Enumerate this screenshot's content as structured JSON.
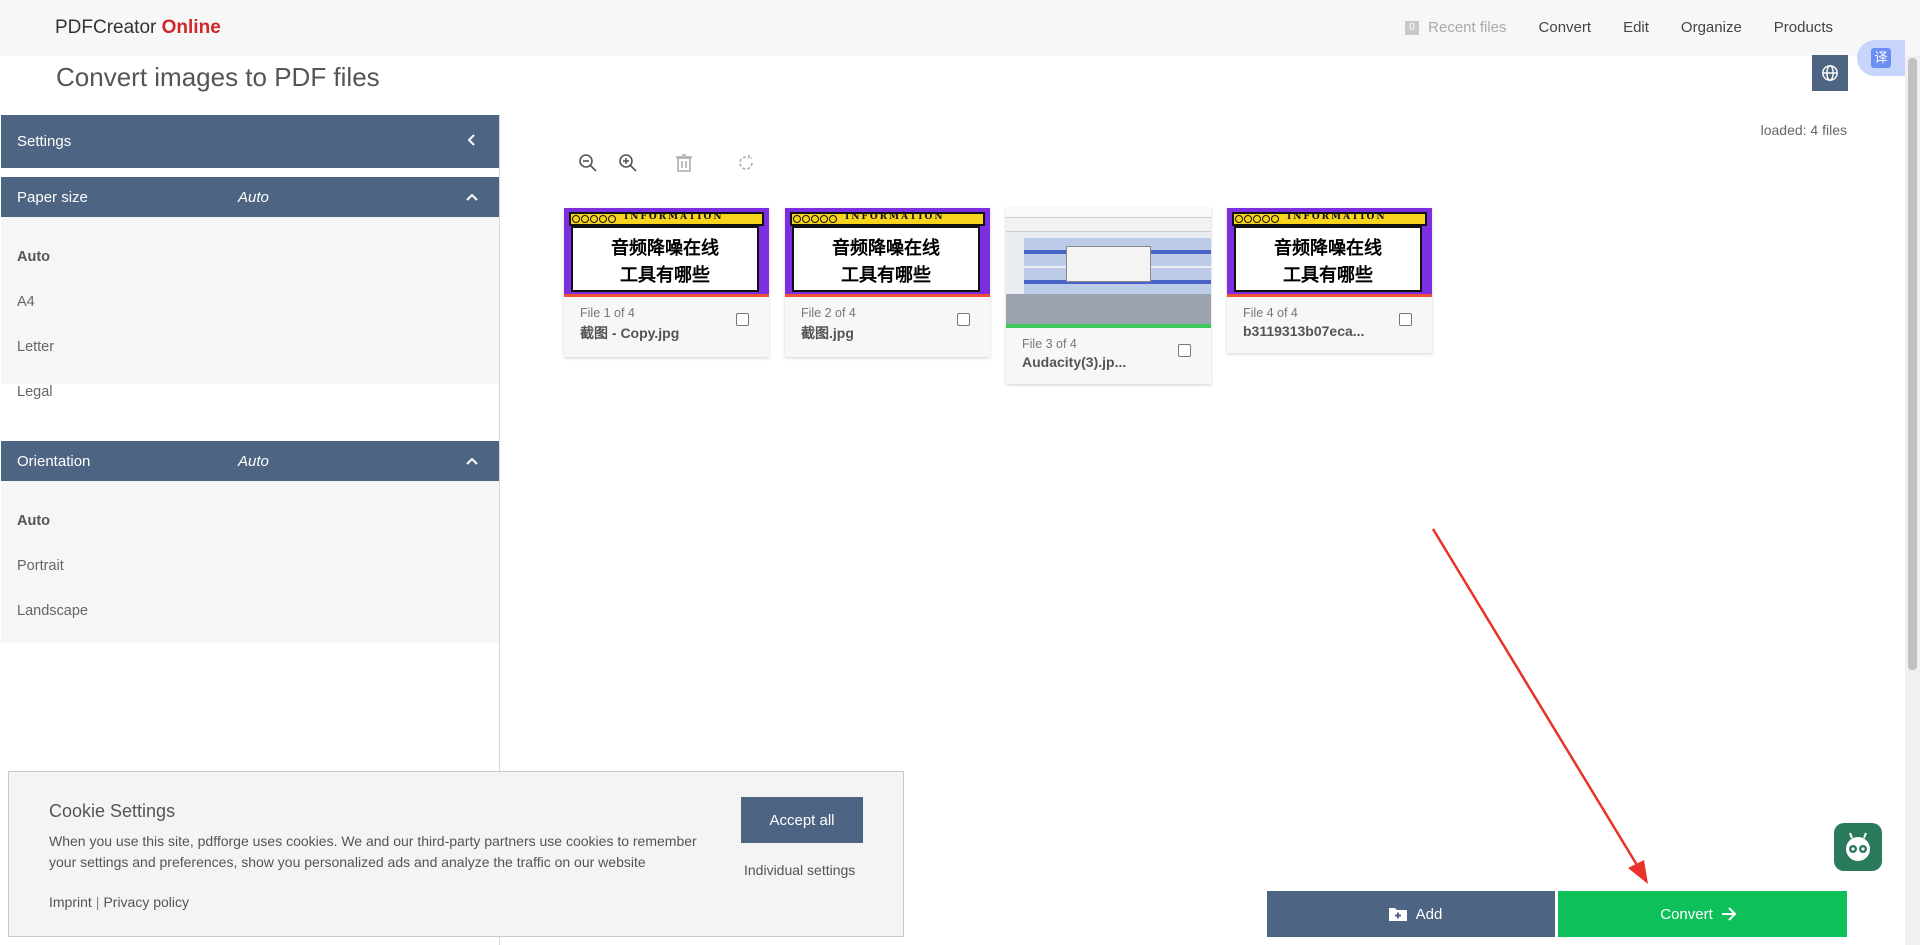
{
  "brand": {
    "name": "PDFCreator",
    "suffix": "Online"
  },
  "nav": {
    "recent_badge": "0",
    "recent": "Recent files",
    "items": [
      "Convert",
      "Edit",
      "Organize",
      "Products"
    ]
  },
  "page": {
    "title": "Convert images to PDF files"
  },
  "translate_label": "译",
  "settings": {
    "title": "Settings",
    "paper_size": {
      "label": "Paper size",
      "value": "Auto",
      "options": [
        "Auto",
        "A4",
        "Letter",
        "Legal"
      ]
    },
    "orientation": {
      "label": "Orientation",
      "value": "Auto",
      "options": [
        "Auto",
        "Portrait",
        "Landscape"
      ]
    }
  },
  "main": {
    "loaded": "loaded: 4 files",
    "files": [
      {
        "num": "File 1 of 4",
        "name": "截图 - Copy.jpg",
        "banner": "INFORMATION",
        "line1": "音频降噪在线",
        "line2": "工具有哪些"
      },
      {
        "num": "File 2 of 4",
        "name": "截图.jpg",
        "banner": "INFORMATION",
        "line1": "音频降噪在线",
        "line2": "工具有哪些"
      },
      {
        "num": "File 3 of 4",
        "name": "Audacity(3).jp..."
      },
      {
        "num": "File 4 of 4",
        "name": "b3119313b07eca...",
        "banner": "INFORMATION",
        "line1": "音频降噪在线",
        "line2": "工具有哪些"
      }
    ]
  },
  "cookie": {
    "title": "Cookie Settings",
    "text": "When you use this site, pdfforge uses cookies. We and our third-party partners use cookies to remember your settings and preferences, show you personalized ads and analyze the traffic on our website",
    "imprint": "Imprint",
    "separator": "|",
    "privacy": "Privacy policy",
    "accept": "Accept all",
    "individual": "Individual settings"
  },
  "actions": {
    "add": "Add",
    "convert": "Convert"
  },
  "colors": {
    "primary": "#4d6582",
    "convert": "#0ec05a",
    "brand_red": "#d0272c",
    "annotation_arrow": "#e8322a"
  }
}
